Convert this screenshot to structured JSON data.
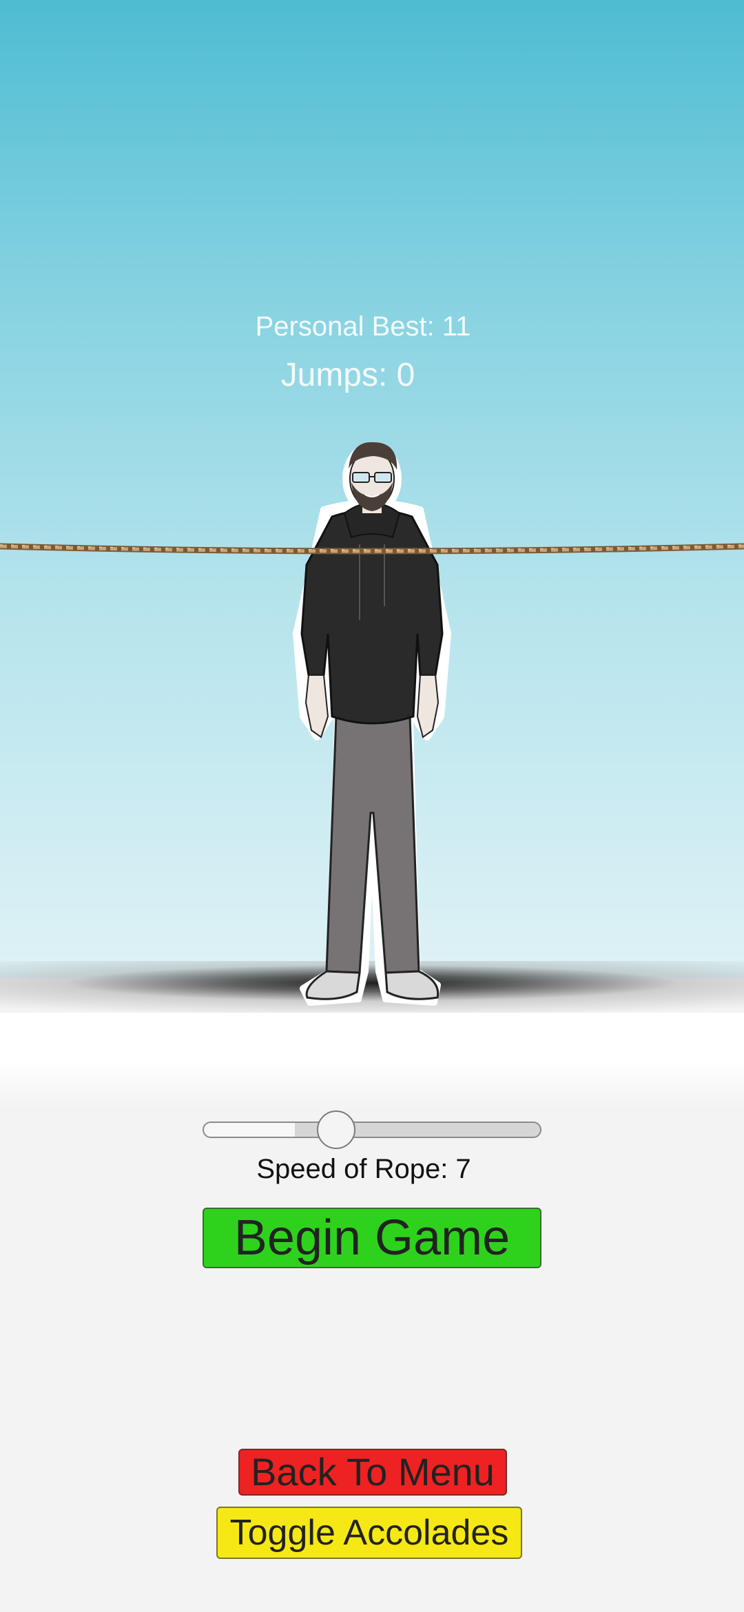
{
  "scoreboard": {
    "personal_best": "Personal Best: 11",
    "jumps": "Jumps: 0"
  },
  "player": {
    "name": "jumper-character"
  },
  "controls": {
    "speed_slider_fraction": 0.4,
    "speed_label": "Speed of Rope: 7",
    "begin_label": "Begin Game",
    "back_label": "Back To Menu",
    "accolades_label": "Toggle Accolades"
  },
  "colors": {
    "sky_top": "#4fbcd2",
    "sky_bottom": "#dff2f6",
    "begin_button": "#2ed21c",
    "menu_button": "#ee2222",
    "accolades_button": "#f5e814",
    "rope": "#b08a5a"
  },
  "icons": {
    "rope": "rope-icon",
    "slider_thumb": "slider-thumb"
  }
}
